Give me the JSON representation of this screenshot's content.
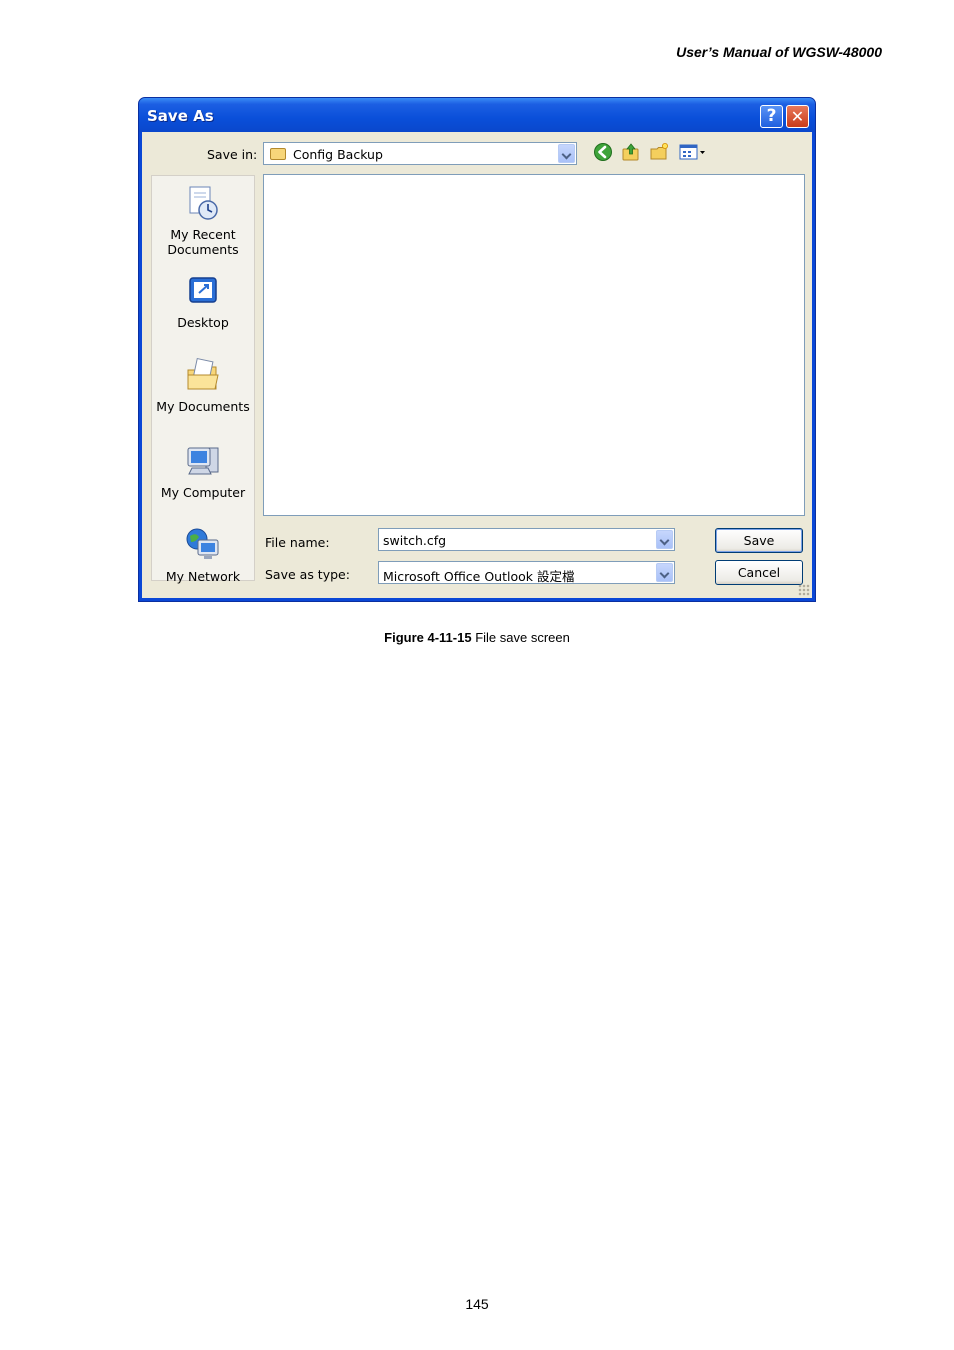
{
  "header": {
    "manual_title": "User’s Manual of WGSW-48000"
  },
  "dialog": {
    "title": "Save As",
    "help_glyph": "?",
    "close_glyph": "✕",
    "save_in_label": "Save in:",
    "save_in_value": "Config Backup",
    "toolbar_icons": [
      "back-icon",
      "up-folder-icon",
      "new-folder-icon",
      "views-menu-icon"
    ],
    "places": [
      {
        "label": "My Recent\nDocuments",
        "icon": "recent-documents-icon"
      },
      {
        "label": "Desktop",
        "icon": "desktop-icon"
      },
      {
        "label": "My Documents",
        "icon": "my-documents-icon"
      },
      {
        "label": "My Computer",
        "icon": "my-computer-icon"
      },
      {
        "label": "My Network",
        "icon": "my-network-icon"
      }
    ],
    "file_name_label": "File name:",
    "file_name_value": "switch.cfg",
    "save_as_type_label": "Save as type:",
    "save_as_type_value": "Microsoft Office Outlook 設定檔",
    "save_button": "Save",
    "cancel_button": "Cancel"
  },
  "caption": {
    "figure_number": "Figure 4-11-15",
    "text": " File save screen"
  },
  "page_number": "145",
  "colors": {
    "title_bar": "#0a4fd9",
    "dialog_face": "#ece9d8",
    "field_border": "#7f9db9"
  }
}
